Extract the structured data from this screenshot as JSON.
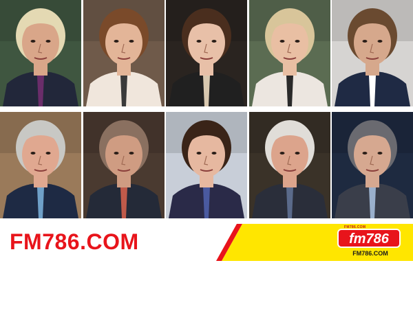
{
  "photos": [
    {
      "subject": "man in suit with purple tie",
      "bg": "#3f5640",
      "skin": "#d9a689",
      "hair": "#e4d9b3",
      "outfit": "#22273a",
      "accent": "#6a2d6a"
    },
    {
      "subject": "woman with brown hair",
      "bg": "#6f5a4a",
      "skin": "#e3b598",
      "hair": "#7a4a2a",
      "outfit": "#f0e6dc",
      "accent": "#3a3a3a"
    },
    {
      "subject": "woman with long brown hair",
      "bg": "#2a2420",
      "skin": "#e8c0a8",
      "hair": "#4a2e1e",
      "outfit": "#202020",
      "accent": "#d8c8b0"
    },
    {
      "subject": "woman with blonde hair",
      "bg": "#5b6c52",
      "skin": "#e9bfa3",
      "hair": "#d8c59a",
      "outfit": "#ece6e0",
      "accent": "#2a2a2a"
    },
    {
      "subject": "man with short brown hair",
      "bg": "#d6d4d2",
      "skin": "#d6a88c",
      "hair": "#6a4a30",
      "outfit": "#1f2a44",
      "accent": "#ffffff"
    },
    {
      "subject": "man with gray hair speaking",
      "bg": "#9a7a5a",
      "skin": "#e0a890",
      "hair": "#c8c8c4",
      "outfit": "#1e2a44",
      "accent": "#6fa0c8"
    },
    {
      "subject": "man speaking with tie",
      "bg": "#4a3a30",
      "skin": "#cf9c82",
      "hair": "#8a7060",
      "outfit": "#242a38",
      "accent": "#c05a4a"
    },
    {
      "subject": "woman with dark hair",
      "bg": "#c8ced8",
      "skin": "#e6b8a0",
      "hair": "#3a2418",
      "outfit": "#2a2a48",
      "accent": "#4a5aa0"
    },
    {
      "subject": "man with white hair speaking",
      "bg": "#3a3228",
      "skin": "#dca48c",
      "hair": "#e0ddd8",
      "outfit": "#2a2e3a",
      "accent": "#5a6a8a"
    },
    {
      "subject": "man in suit",
      "bg": "#1e2a40",
      "skin": "#d6a890",
      "hair": "#6a6a70",
      "outfit": "#3a3e4a",
      "accent": "#9ab0cc"
    }
  ],
  "banner": {
    "site_text": "FM786.COM",
    "logo_main": "fm786",
    "logo_sub": "FM786.COM",
    "logo_top": "FM786.COM",
    "colors": {
      "red": "#e8141b",
      "yellow": "#ffe600",
      "dark": "#1a1a1a"
    }
  }
}
